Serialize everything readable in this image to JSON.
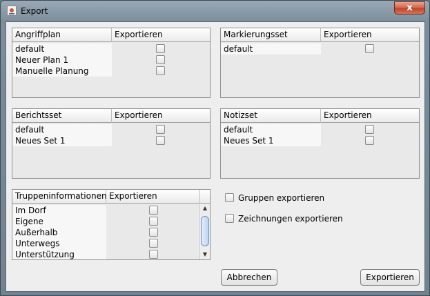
{
  "window": {
    "title": "Export",
    "close_label": "x"
  },
  "angriffsplan": {
    "col_name": "Angriffplan",
    "col_export": "Exportieren",
    "rows": [
      "default",
      "Neuer Plan 1",
      "Manuelle Planung"
    ]
  },
  "markierungsset": {
    "col_name": "Markierungsset",
    "col_export": "Exportieren",
    "rows": [
      "default"
    ]
  },
  "berichtsset": {
    "col_name": "Berichtsset",
    "col_export": "Exportieren",
    "rows": [
      "default",
      "Neues Set 1"
    ]
  },
  "notizset": {
    "col_name": "Notizset",
    "col_export": "Exportieren",
    "rows": [
      "default",
      "Neues Set 1"
    ]
  },
  "truppeninformationen": {
    "col_name": "Truppeninformationen",
    "col_export": "Exportieren",
    "rows": [
      "Im Dorf",
      "Eigene",
      "Außerhalb",
      "Unterwegs",
      "Unterstützung"
    ],
    "scroll_up": "▲",
    "scroll_down": "▼"
  },
  "options": {
    "gruppen": "Gruppen exportieren",
    "zeichnungen": "Zeichnungen exportieren"
  },
  "buttons": {
    "cancel": "Abbrechen",
    "export": "Exportieren"
  }
}
